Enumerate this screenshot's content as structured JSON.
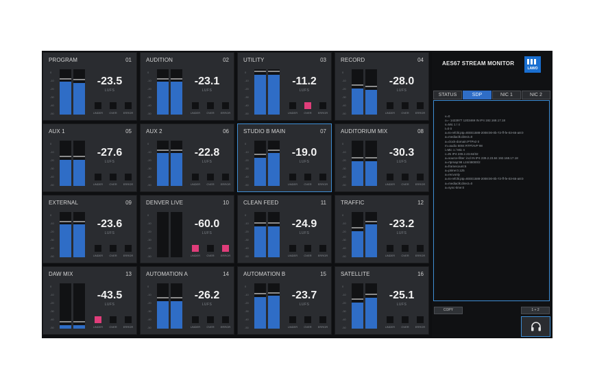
{
  "panel": {
    "title": "AES67 STREAM MONITOR",
    "logo_text": "LAWO",
    "tabs": [
      {
        "label": "STATUS",
        "active": false
      },
      {
        "label": "SDP",
        "active": true
      },
      {
        "label": "NIC 1",
        "active": false
      },
      {
        "label": "NIC 2",
        "active": false
      }
    ],
    "sdp_lines": [
      "v=0",
      "o=- 1423977 1203469 IN IP4 192.168.17.18",
      "s=Mic 1 / 4",
      "t=0 0",
      "a=ts-refclk:ptp=IEEE1588-2008:00-0b-72-ff-fe-03-65-a8:0",
      "a=mediaclk:direct=0",
      "a=clock-domain:PTPv2 0",
      "m=audio 5004 RTP/AVP 98",
      "i=Mic 1 / Mic 4",
      "c=IN IP4 239.2.23.84/32",
      "a=source-filter: incl IN IP4 239.2.23.84 192.168.17.18",
      "a=rtpmap:98 L24/48000/2",
      "a=framecount:6",
      "a=ptime:0.125",
      "a=recvonly",
      "a=ts-refclk:ptp=IEEE1588-2008:00-0b-72-ff-fe-03-65-a8:0",
      "a=mediaclk:direct=0",
      "a=sync-time:0"
    ],
    "copy_label": "COPY",
    "select_label": "1 + 2",
    "headphone_icon": "headphones-icon"
  },
  "meter_scale": [
    "0",
    "-10",
    "-20",
    "-30",
    "-40",
    "-50"
  ],
  "indicator_labels": [
    "UNDER",
    "OVER",
    "ERROR"
  ],
  "unit_label": "LUFS",
  "accent_color": "#2f6dc6",
  "alarm_color": "#e03d7a",
  "tiles": [
    {
      "name": "PROGRAM",
      "num": "01",
      "value": "-23.5",
      "levels": [
        0.72,
        0.7
      ],
      "alarms": [
        false,
        false,
        false
      ],
      "selected": false
    },
    {
      "name": "AUDITION",
      "num": "02",
      "value": "-23.1",
      "levels": [
        0.72,
        0.72
      ],
      "alarms": [
        false,
        false,
        false
      ],
      "selected": false
    },
    {
      "name": "UTILITY",
      "num": "03",
      "value": "-11.2",
      "levels": [
        0.88,
        0.88
      ],
      "alarms": [
        false,
        true,
        false
      ],
      "selected": false
    },
    {
      "name": "RECORD",
      "num": "04",
      "value": "-28.0",
      "levels": [
        0.58,
        0.55
      ],
      "alarms": [
        false,
        false,
        false
      ],
      "selected": false
    },
    {
      "name": "AUX 1",
      "num": "05",
      "value": "-27.6",
      "levels": [
        0.58,
        0.58
      ],
      "alarms": [
        false,
        false,
        false
      ],
      "selected": false
    },
    {
      "name": "AUX 2",
      "num": "06",
      "value": "-22.8",
      "levels": [
        0.72,
        0.72
      ],
      "alarms": [
        false,
        false,
        false
      ],
      "selected": false
    },
    {
      "name": "STUDIO B MAIN",
      "num": "07",
      "value": "-19.0",
      "levels": [
        0.62,
        0.72
      ],
      "alarms": [
        false,
        false,
        false
      ],
      "selected": true
    },
    {
      "name": "AUDITORIUM MIX",
      "num": "08",
      "value": "-30.3",
      "levels": [
        0.55,
        0.55
      ],
      "alarms": [
        false,
        false,
        false
      ],
      "selected": false
    },
    {
      "name": "EXTERNAL",
      "num": "09",
      "value": "-23.6",
      "levels": [
        0.72,
        0.72
      ],
      "alarms": [
        false,
        false,
        false
      ],
      "selected": false
    },
    {
      "name": "DENVER LIVE",
      "num": "10",
      "value": "-60.0",
      "levels": [
        0.0,
        0.0
      ],
      "alarms": [
        true,
        false,
        true
      ],
      "selected": false
    },
    {
      "name": "CLEAN FEED",
      "num": "11",
      "value": "-24.9",
      "levels": [
        0.68,
        0.68
      ],
      "alarms": [
        false,
        false,
        false
      ],
      "selected": false
    },
    {
      "name": "TRAFFIC",
      "num": "12",
      "value": "-23.2",
      "levels": [
        0.58,
        0.72
      ],
      "alarms": [
        false,
        false,
        false
      ],
      "selected": false
    },
    {
      "name": "DAW MIX",
      "num": "13",
      "value": "-43.5",
      "levels": [
        0.08,
        0.08
      ],
      "alarms": [
        true,
        false,
        false
      ],
      "selected": false
    },
    {
      "name": "AUTOMATION A",
      "num": "14",
      "value": "-26.2",
      "levels": [
        0.6,
        0.6
      ],
      "alarms": [
        false,
        false,
        false
      ],
      "selected": false
    },
    {
      "name": "AUTOMATION B",
      "num": "15",
      "value": "-23.7",
      "levels": [
        0.7,
        0.72
      ],
      "alarms": [
        false,
        false,
        false
      ],
      "selected": false
    },
    {
      "name": "SATELLITE",
      "num": "16",
      "value": "-25.1",
      "levels": [
        0.58,
        0.68
      ],
      "alarms": [
        false,
        false,
        false
      ],
      "selected": false
    }
  ]
}
